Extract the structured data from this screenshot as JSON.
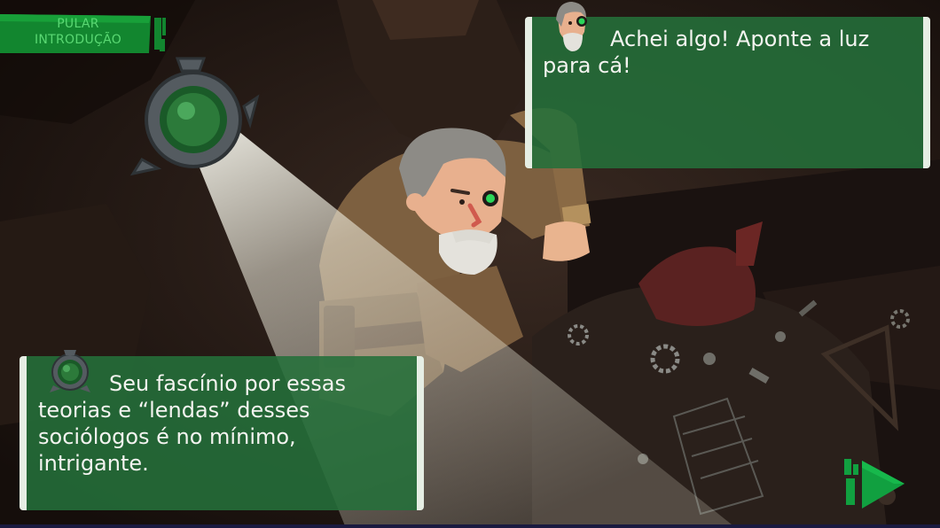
{
  "skip_button": {
    "line1": "PULAR",
    "line2": "INTRODUÇÃO"
  },
  "dialogs": {
    "top": {
      "speaker_icon": "professor-avatar-icon",
      "text": "Achei algo! Aponte a luz para cá!"
    },
    "bottom": {
      "speaker_icon": "device-avatar-icon",
      "text": "Seu fascínio por essas teorias e “lendas” desses sociólogos é no mínimo, intrigante."
    }
  },
  "next_button": {
    "icon": "next-arrow-icon"
  },
  "scene": {
    "flashlight_device_icon": "flashlight-device-icon",
    "character": "professor-character"
  },
  "colors": {
    "panel_green": "#24703a",
    "border": "#e6eee4",
    "accent_green": "#11a040",
    "skip_text": "#5ad873",
    "background": "#1e1511"
  }
}
